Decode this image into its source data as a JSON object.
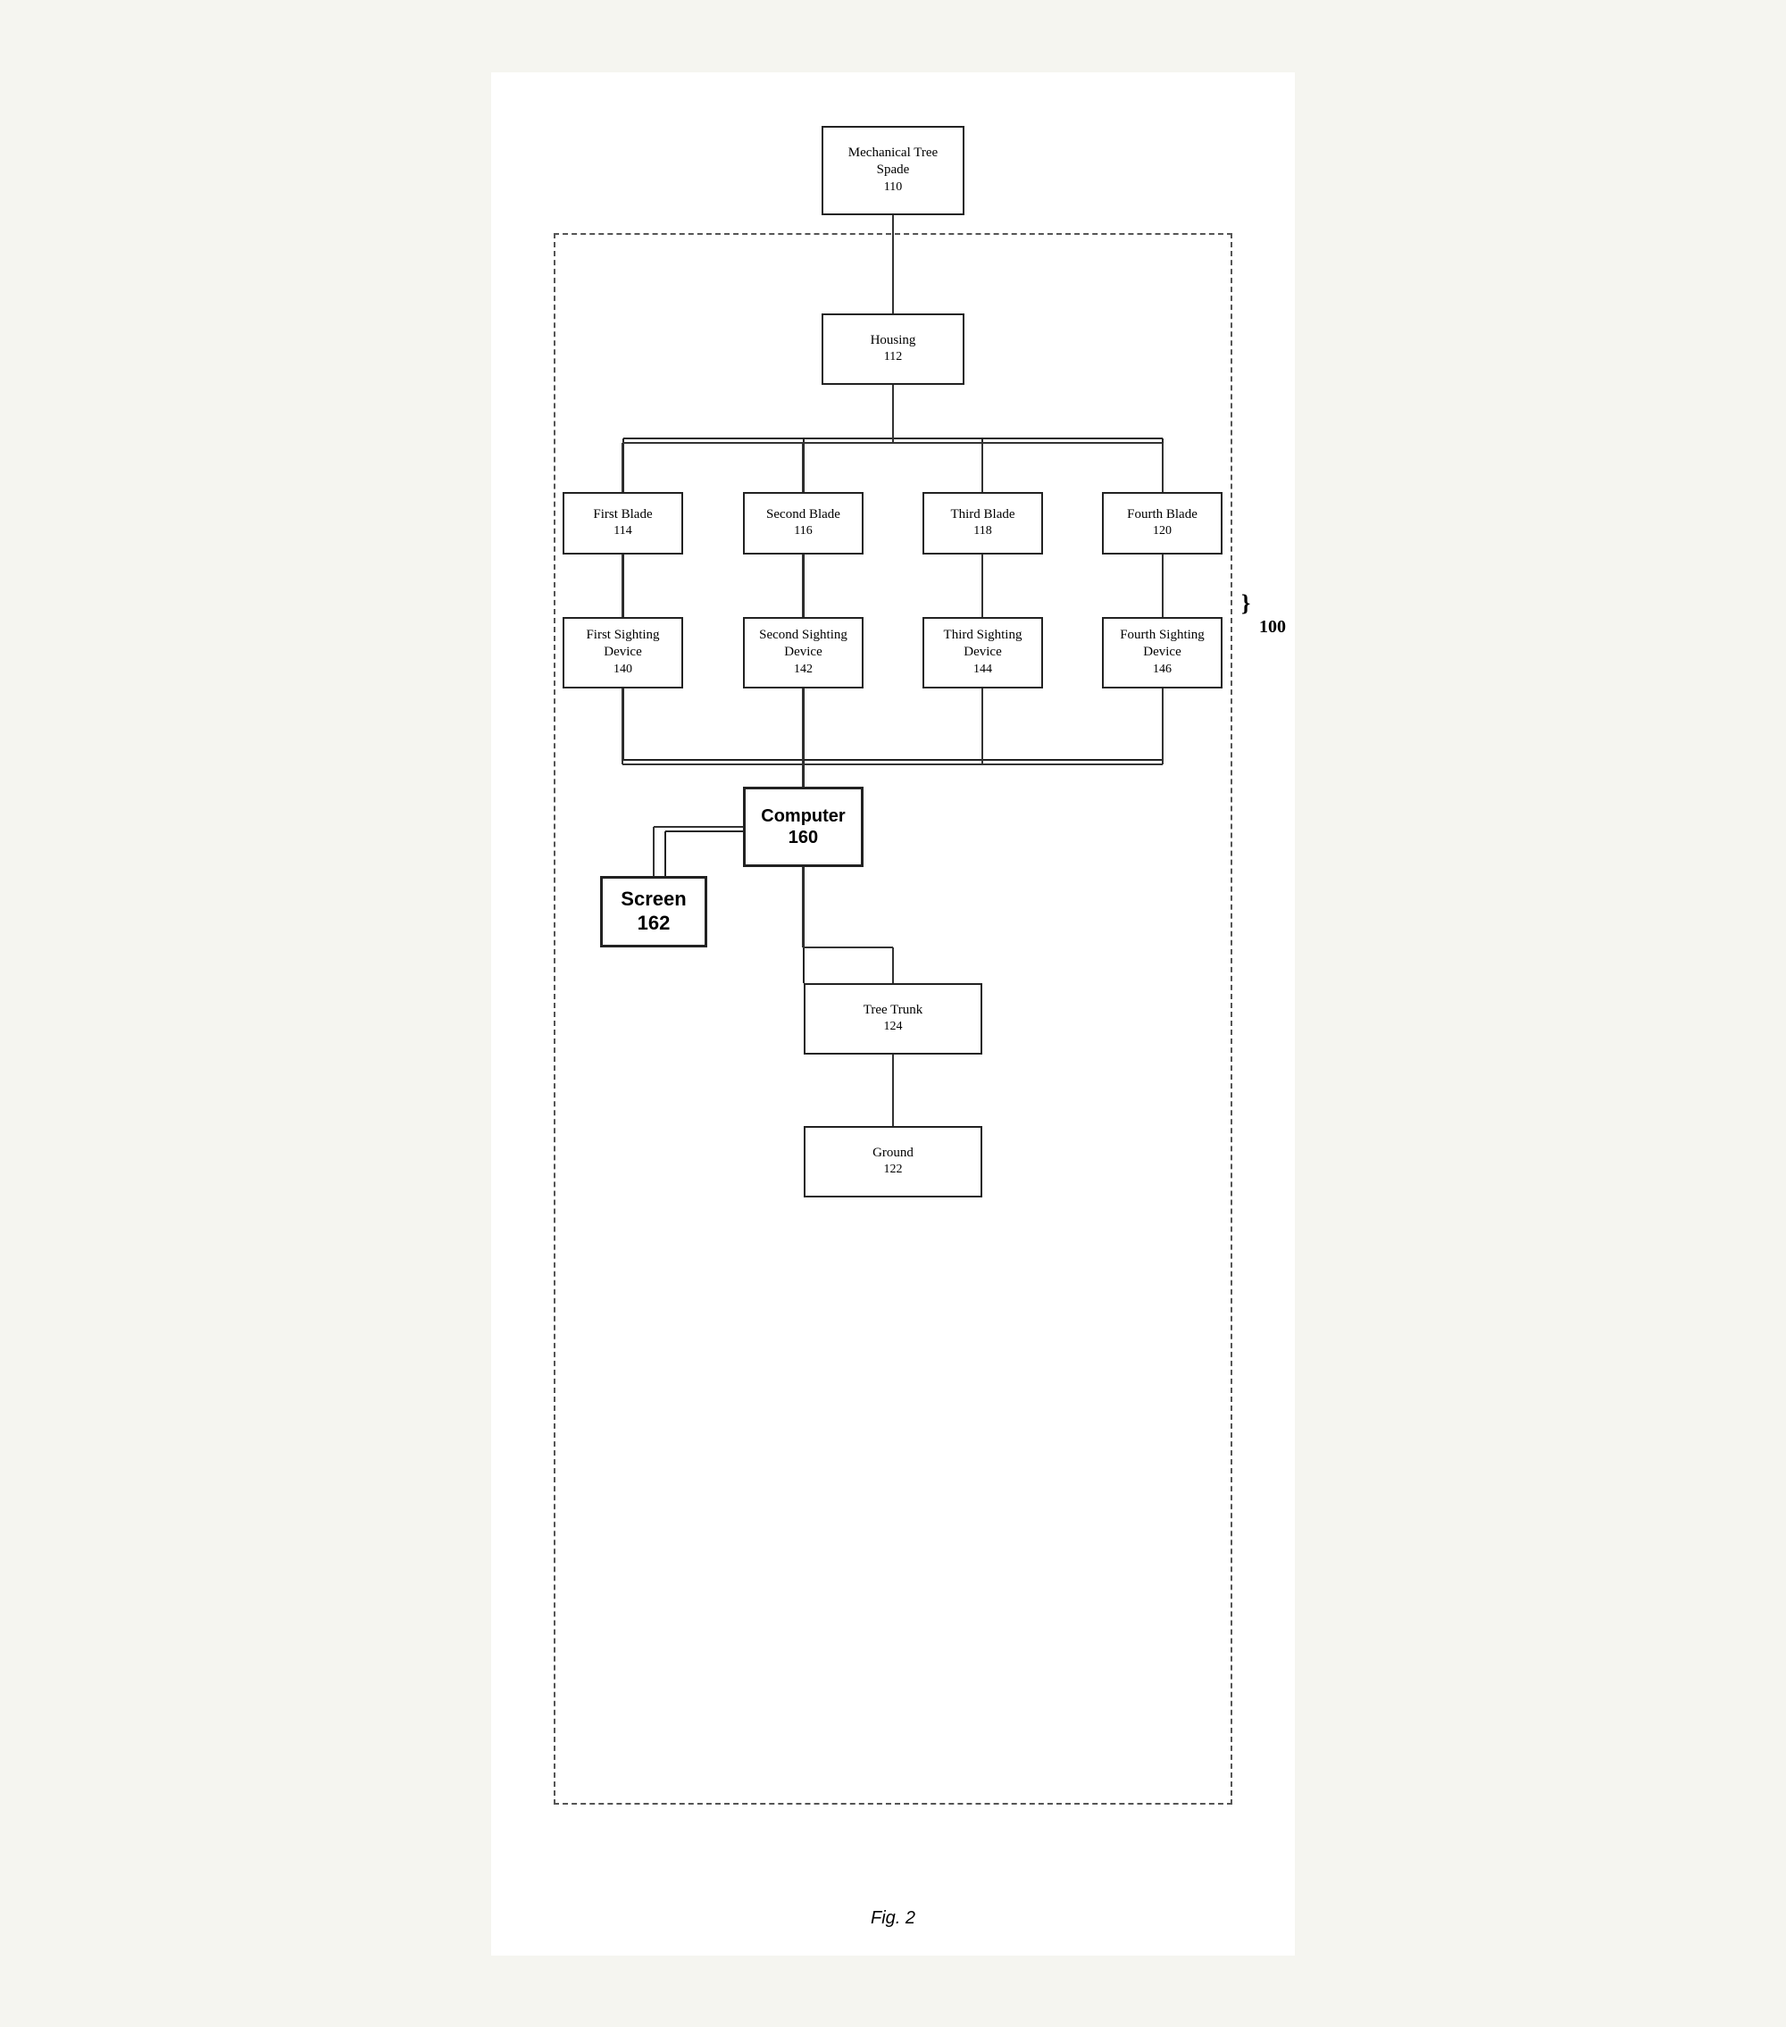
{
  "title": "Fig. 2",
  "nodes": {
    "mechanical_tree_spade": {
      "label": "Mechanical\nTree Spade",
      "number": "110"
    },
    "housing": {
      "label": "Housing",
      "number": "112"
    },
    "first_blade": {
      "label": "First Blade",
      "number": "114"
    },
    "second_blade": {
      "label": "Second Blade",
      "number": "116"
    },
    "third_blade": {
      "label": "Third Blade",
      "number": "118"
    },
    "fourth_blade": {
      "label": "Fourth Blade",
      "number": "120"
    },
    "first_sighting": {
      "label": "First\nSighting Device",
      "number": "140"
    },
    "second_sighting": {
      "label": "Second\nSighting Device",
      "number": "142"
    },
    "third_sighting": {
      "label": "Third\nSighting Device",
      "number": "144"
    },
    "fourth_sighting": {
      "label": "Fourth\nSighting Device",
      "number": "146"
    },
    "computer": {
      "label": "Computer\n160"
    },
    "screen": {
      "label": "Screen\n162"
    },
    "tree_trunk": {
      "label": "Tree Trunk",
      "number": "124"
    },
    "ground": {
      "label": "Ground",
      "number": "122"
    },
    "system_label": {
      "number": "100"
    }
  }
}
